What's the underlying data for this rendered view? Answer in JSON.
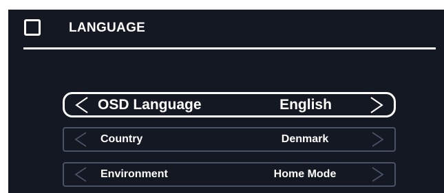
{
  "header": {
    "title": "LANGUAGE",
    "icon": "square-outline-icon"
  },
  "menu": {
    "items": [
      {
        "label": "OSD Language",
        "value": "English",
        "selected": true
      },
      {
        "label": "Country",
        "value": "Denmark",
        "selected": false
      },
      {
        "label": "Environment",
        "value": "Home Mode",
        "selected": false
      }
    ]
  },
  "colors": {
    "panel_background": "#141822",
    "text": "#ffffff",
    "selected_border": "#ffffff",
    "row_border": "#4a5265",
    "inactive_arrow": "#4a5265"
  }
}
